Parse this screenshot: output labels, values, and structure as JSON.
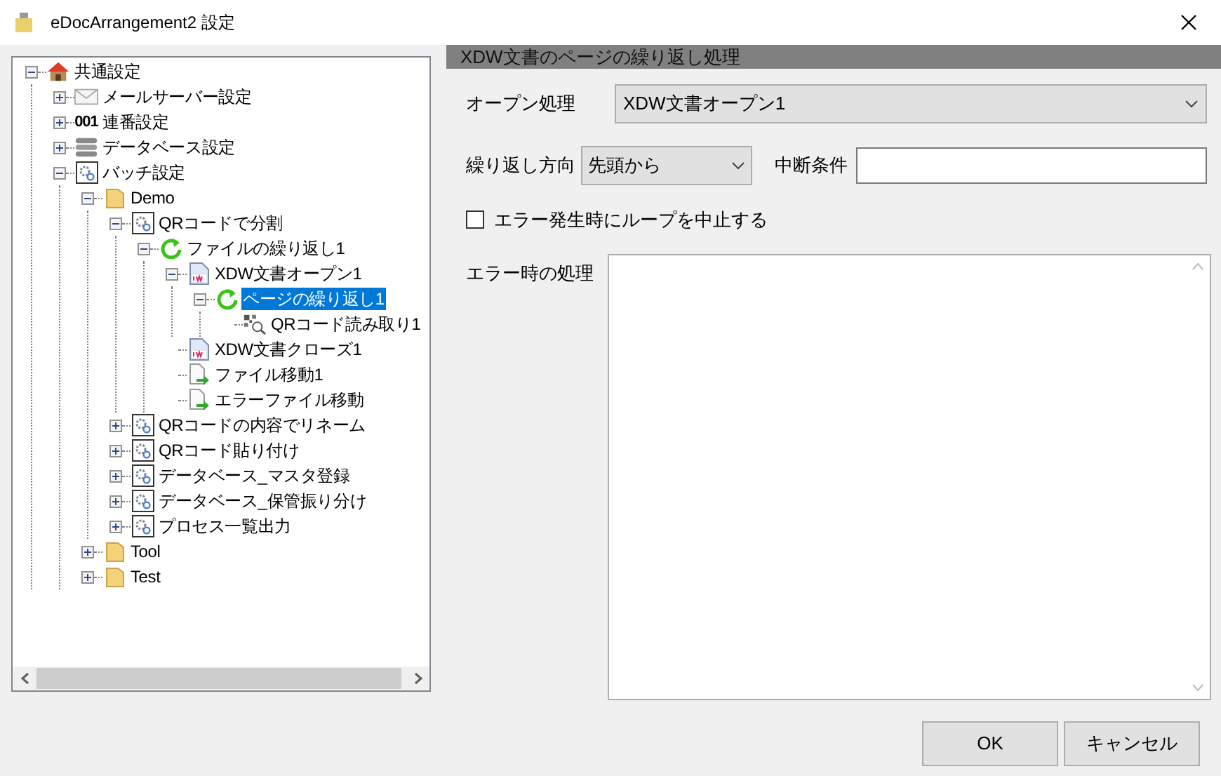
{
  "window": {
    "title": "eDocArrangement2 設定"
  },
  "tree": [
    {
      "label": "共通設定",
      "kind": "home",
      "expanded": true,
      "selected": false,
      "children": [
        {
          "label": "メールサーバー設定",
          "kind": "mail",
          "expanded": false,
          "selected": false
        },
        {
          "label": "連番設定",
          "kind": "number",
          "badge": "001",
          "expanded": false,
          "selected": false
        },
        {
          "label": "データベース設定",
          "kind": "database",
          "expanded": false,
          "selected": false
        },
        {
          "label": "バッチ設定",
          "kind": "batch",
          "expanded": true,
          "selected": false,
          "children": [
            {
              "label": "Demo",
              "kind": "folder",
              "expanded": true,
              "selected": false,
              "children": [
                {
                  "label": "QRコードで分割",
                  "kind": "batch",
                  "expanded": true,
                  "selected": false,
                  "children": [
                    {
                      "label": "ファイルの繰り返し1",
                      "kind": "loop",
                      "expanded": true,
                      "selected": false,
                      "children": [
                        {
                          "label": "XDW文書オープン1",
                          "kind": "xdw",
                          "expanded": true,
                          "selected": false,
                          "children": [
                            {
                              "label": "ページの繰り返し1",
                              "kind": "loop",
                              "expanded": true,
                              "selected": true,
                              "children": [
                                {
                                  "label": "QRコード読み取り1",
                                  "kind": "qr",
                                  "selected": false
                                }
                              ]
                            }
                          ]
                        },
                        {
                          "label": "XDW文書クローズ1",
                          "kind": "xdw",
                          "selected": false
                        },
                        {
                          "label": "ファイル移動1",
                          "kind": "move",
                          "selected": false
                        },
                        {
                          "label": "エラーファイル移動",
                          "kind": "move",
                          "selected": false
                        }
                      ]
                    }
                  ]
                },
                {
                  "label": "QRコードの内容でリネーム",
                  "kind": "batch",
                  "expanded": false,
                  "selected": false
                },
                {
                  "label": "QRコード貼り付け",
                  "kind": "batch",
                  "expanded": false,
                  "selected": false
                },
                {
                  "label": "データベース_マスタ登録",
                  "kind": "batch",
                  "expanded": false,
                  "selected": false
                },
                {
                  "label": "データベース_保管振り分け",
                  "kind": "batch",
                  "expanded": false,
                  "selected": false
                },
                {
                  "label": "プロセス一覧出力",
                  "kind": "batch",
                  "expanded": false,
                  "selected": false
                }
              ]
            },
            {
              "label": "Tool",
              "kind": "folder",
              "expanded": false,
              "selected": false
            },
            {
              "label": "Test",
              "kind": "folder",
              "expanded": false,
              "selected": false
            }
          ]
        }
      ]
    }
  ],
  "panel": {
    "header": "XDW文書のページの繰り返し処理",
    "open_process": {
      "label": "オープン処理",
      "value": "XDW文書オープン1"
    },
    "direction": {
      "label": "繰り返し方向",
      "value": "先頭から"
    },
    "break_condition": {
      "label": "中断条件"
    },
    "stop_on_error": {
      "label": "エラー発生時にループを中止する",
      "checked": false
    },
    "error_process": {
      "label": "エラー時の処理"
    }
  },
  "buttons": [
    "OK",
    "キャンセル"
  ]
}
